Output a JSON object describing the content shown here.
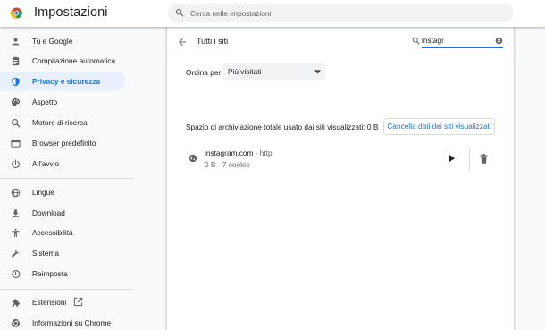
{
  "header": {
    "title": "Impostazioni",
    "search_placeholder": "Cerca nelle impostazioni",
    "logo_icon": "chrome-logo-icon"
  },
  "sidebar": {
    "items": [
      {
        "label": "Tu e Google",
        "icon": "person-icon"
      },
      {
        "label": "Compilazione automatica",
        "icon": "clipboard-icon"
      },
      {
        "label": "Privacy e sicurezza",
        "icon": "shield-icon",
        "active": true
      },
      {
        "label": "Aspetto",
        "icon": "palette-icon"
      },
      {
        "label": "Motore di ricerca",
        "icon": "search-icon"
      },
      {
        "label": "Browser predefinito",
        "icon": "browser-icon"
      },
      {
        "label": "All'avvio",
        "icon": "power-icon"
      },
      {
        "label": "Lingue",
        "icon": "globe-icon"
      },
      {
        "label": "Download",
        "icon": "download-icon"
      },
      {
        "label": "Accessibilità",
        "icon": "accessibility-icon"
      },
      {
        "label": "Sistema",
        "icon": "wrench-icon"
      },
      {
        "label": "Reimposta",
        "icon": "history-icon"
      },
      {
        "label": "Estensioni",
        "icon": "puzzle-icon",
        "external_icon": "open-external-icon"
      },
      {
        "label": "Informazioni su Chrome",
        "icon": "chrome-icon"
      }
    ]
  },
  "main": {
    "title": "Tutti i siti",
    "filter_value": "instagr",
    "sort_label": "Ordina per",
    "sort_value": "Più visitati",
    "storage_text": "Spazio di archiviazione totale usato dai siti visualizzati: 0 B",
    "clear_button": "Cancella dati dei siti visualizzati",
    "sites": [
      {
        "name": "instagram.com",
        "protocol": " - http",
        "info": "0 B · 7 cookie"
      }
    ]
  },
  "colors": {
    "accent": "#1a73e8",
    "active_bg": "#e8f0fe",
    "page_bg": "#f8f9fa",
    "text_secondary": "#5f6368"
  }
}
